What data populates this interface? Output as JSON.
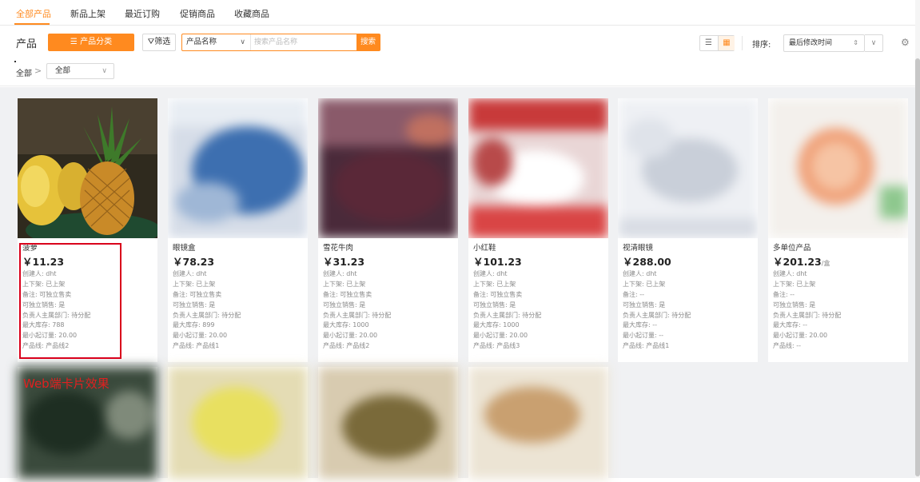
{
  "tabs": [
    {
      "label": "全部产品",
      "active": true
    },
    {
      "label": "新品上架",
      "active": false
    },
    {
      "label": "最近订购",
      "active": false
    },
    {
      "label": "促销商品",
      "active": false
    },
    {
      "label": "收藏商品",
      "active": false
    }
  ],
  "toolbar": {
    "title": "产品",
    "category_button": "☰ 产品分类",
    "filter_button": "筛选",
    "search_field": "产品名称",
    "search_placeholder": "搜索产品名称",
    "search_button": "搜索",
    "sort_label": "排序:",
    "sort_value": "最后修改时间"
  },
  "breadcrumb": {
    "home": "全部",
    "separator": ">",
    "select_value": "全部"
  },
  "colors": {
    "accent": "#ff8a1f",
    "highlight": "#d9001b",
    "annotation": "#e02020"
  },
  "products": [
    {
      "name": "菠萝",
      "price": "￥11.23",
      "unit": "",
      "attrs": [
        "创建人: dht",
        "上下架: 已上架",
        "备注: 可独立售卖",
        "可独立销售: 是",
        "负责人主属部门: 待分配",
        "最大库存: 788",
        "最小起订量: 20.00",
        "产品线: 产品线2"
      ]
    },
    {
      "name": "眼镜盒",
      "price": "￥78.23",
      "unit": "",
      "attrs": [
        "创建人: dht",
        "上下架: 已上架",
        "备注: 可独立售卖",
        "可独立销售: 是",
        "负责人主属部门: 待分配",
        "最大库存: 899",
        "最小起订量: 20.00",
        "产品线: 产品线1"
      ]
    },
    {
      "name": "雪花牛肉",
      "price": "￥31.23",
      "unit": "",
      "attrs": [
        "创建人: dht",
        "上下架: 已上架",
        "备注: 可独立售卖",
        "可独立销售: 是",
        "负责人主属部门: 待分配",
        "最大库存: 1000",
        "最小起订量: 20.00",
        "产品线: 产品线2"
      ]
    },
    {
      "name": "小红鞋",
      "price": "￥101.23",
      "unit": "",
      "attrs": [
        "创建人: dht",
        "上下架: 已上架",
        "备注: 可独立售卖",
        "可独立销售: 是",
        "负责人主属部门: 待分配",
        "最大库存: 1000",
        "最小起订量: 20.00",
        "产品线: 产品线3"
      ]
    },
    {
      "name": "视清眼镜",
      "price": "￥288.00",
      "unit": "",
      "attrs": [
        "创建人: dht",
        "上下架: 已上架",
        "备注: --",
        "可独立销售: 是",
        "负责人主属部门: 待分配",
        "最大库存: --",
        "最小起订量: --",
        "产品线: 产品线1"
      ]
    },
    {
      "name": "多单位产品",
      "price": "￥201.23",
      "unit": "/盒",
      "attrs": [
        "创建人: dht",
        "上下架: 已上架",
        "备注: --",
        "可独立销售: 是",
        "负责人主属部门: 待分配",
        "最大库存: --",
        "最小起订量: 20.00",
        "产品线: --"
      ]
    }
  ],
  "annotation": "Web端卡片效果"
}
